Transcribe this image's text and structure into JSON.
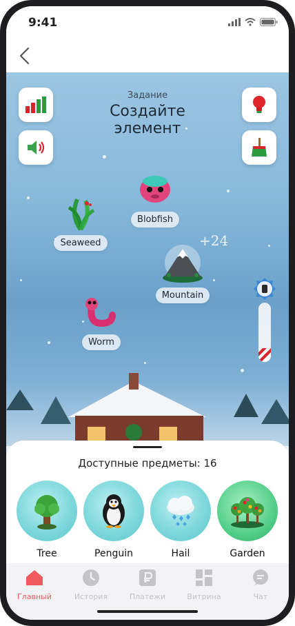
{
  "status": {
    "time": "9:41"
  },
  "task": {
    "caption": "Задание",
    "title": "Создайте элемент"
  },
  "elements": {
    "blobfish": "Blobfish",
    "seaweed": "Seaweed",
    "mountain": "Mountain",
    "worm": "Worm"
  },
  "bonus": "+24",
  "panel": {
    "title": "Доступные предметы: 16",
    "items": [
      "Tree",
      "Penguin",
      "Hail",
      "Garden"
    ]
  },
  "tabs": [
    "Главный",
    "История",
    "Платежи",
    "Витрина",
    "Чат"
  ],
  "colors": {
    "accent": "#ef5a5e",
    "inactive": "#c3c3c8",
    "selected_item": "#54cf8a"
  }
}
